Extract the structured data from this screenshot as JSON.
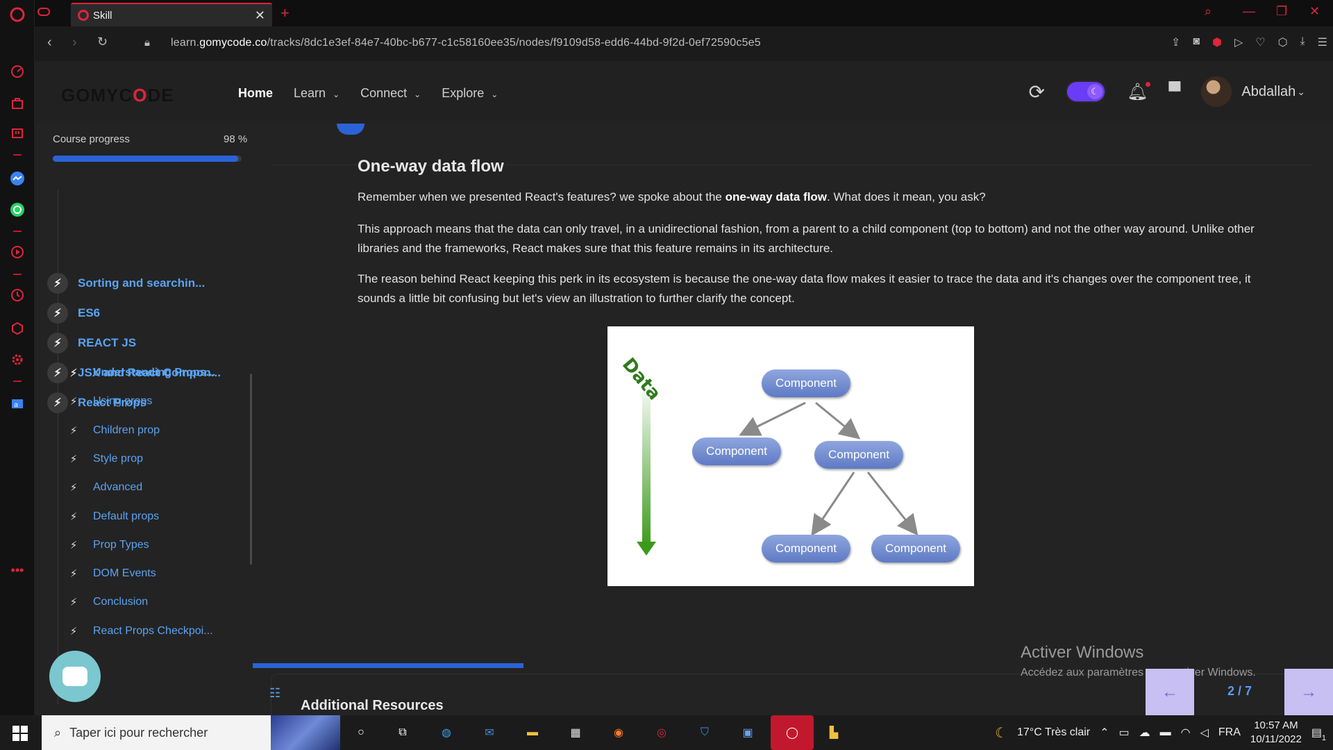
{
  "browser": {
    "tab_title": "Skill",
    "url_prefix": "learn.",
    "url_domain": "gomycode.co",
    "url_path": "/tracks/8dc1e3ef-84e7-40bc-b677-c1c58160ee35/nodes/f9109d58-edd6-44bd-9f2d-0ef72590c5e5"
  },
  "site": {
    "logo_left": "GOMYC",
    "logo_mid": "O",
    "logo_right": "DE",
    "nav": [
      {
        "label": "Home"
      },
      {
        "label": "Learn"
      },
      {
        "label": "Connect"
      },
      {
        "label": "Explore"
      }
    ],
    "username": "Abdallah"
  },
  "sidebar": {
    "progress_label": "Course progress",
    "progress_value": "98 %",
    "progress_fraction": 0.98,
    "chapters": [
      {
        "label": "Sorting and searchin..."
      },
      {
        "label": "ES6"
      },
      {
        "label": "REACT JS"
      },
      {
        "label": "JSX and React Compon..."
      },
      {
        "label": "React Props"
      }
    ],
    "lessons": [
      {
        "label": "Understanding Props..."
      },
      {
        "label": "Using props"
      },
      {
        "label": "Children prop"
      },
      {
        "label": "Style prop"
      },
      {
        "label": "Advanced"
      },
      {
        "label": "Default props"
      },
      {
        "label": "Prop Types"
      },
      {
        "label": "DOM Events"
      },
      {
        "label": "Conclusion"
      },
      {
        "label": "React Props Checkpoi..."
      }
    ]
  },
  "content": {
    "title": "One-way data flow",
    "p1_before": "Remember when we presented React's features? we spoke about the ",
    "p1_bold": "one-way data flow",
    "p1_after": ". What does it mean, you ask?",
    "p2": "This approach means that the data can only travel, in a unidirectional fashion, from a parent to a child component (top to bottom) and not the other way around. Unlike other libraries and the frameworks, React makes sure that this feature remains in its architecture.",
    "p3": "The reason behind React keeping this perk in its ecosystem is because the one-way data flow makes it easier to trace the data and it's changes over the component tree, it sounds a little bit confusing but let's view an illustration to further clarify the concept.",
    "diagram": {
      "data_label": "Data",
      "nodes": [
        "Component",
        "Component",
        "Component",
        "Component",
        "Component"
      ]
    },
    "resources_title": "Additional Resources"
  },
  "pager": {
    "page": "2 / 7"
  },
  "watermark": {
    "line1": "Activer Windows",
    "line2": "Accédez aux paramètres pour activer Windows."
  },
  "taskbar": {
    "search_placeholder": "Taper ici pour rechercher",
    "weather": "17°C  Très clair",
    "lang": "FRA",
    "time": "10:57 AM",
    "date": "10/11/2022",
    "notif_count": "1"
  },
  "colors": {
    "accent": "#2b63d6",
    "link": "#5aa3f2",
    "opera_red": "#e0243b"
  }
}
